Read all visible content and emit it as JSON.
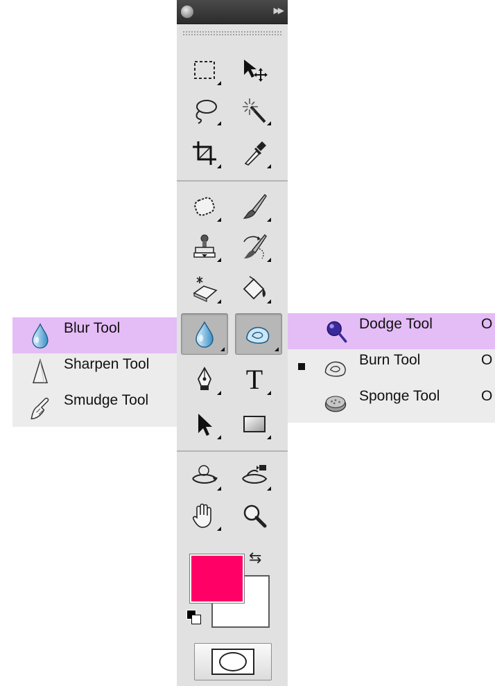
{
  "toolbar": {
    "tools": [
      {
        "name": "rectangular-marquee",
        "icon": "marquee-icon"
      },
      {
        "name": "move",
        "icon": "move-icon"
      },
      {
        "name": "lasso",
        "icon": "lasso-icon"
      },
      {
        "name": "magic-wand",
        "icon": "magic-wand-icon"
      },
      {
        "name": "crop",
        "icon": "crop-icon"
      },
      {
        "name": "eyedropper",
        "icon": "eyedropper-icon"
      },
      {
        "name": "spot-healing",
        "icon": "bandage-icon"
      },
      {
        "name": "brush",
        "icon": "brush-icon"
      },
      {
        "name": "clone-stamp",
        "icon": "stamp-icon"
      },
      {
        "name": "history-brush",
        "icon": "history-brush-icon"
      },
      {
        "name": "eraser",
        "icon": "eraser-icon"
      },
      {
        "name": "paint-bucket",
        "icon": "paint-bucket-icon"
      },
      {
        "name": "blur",
        "icon": "blur-drop-icon",
        "active": true
      },
      {
        "name": "dodge",
        "icon": "dodge-icon",
        "active": true
      },
      {
        "name": "pen",
        "icon": "pen-icon"
      },
      {
        "name": "type",
        "icon": "type-icon",
        "glyph": "T"
      },
      {
        "name": "path-selection",
        "icon": "arrow-icon"
      },
      {
        "name": "rectangle-shape",
        "icon": "rectangle-icon"
      },
      {
        "name": "3d-rotate",
        "icon": "3d-rotate-icon"
      },
      {
        "name": "3d-orbit",
        "icon": "3d-orbit-icon"
      },
      {
        "name": "hand",
        "icon": "hand-icon"
      },
      {
        "name": "zoom",
        "icon": "zoom-icon"
      }
    ],
    "colors": {
      "foreground": "#ff0066",
      "background": "#ffffff"
    }
  },
  "blur_menu": {
    "items": [
      {
        "label": "Blur Tool",
        "icon": "blur-drop-icon",
        "highlighted": true
      },
      {
        "label": "Sharpen Tool",
        "icon": "sharpen-icon"
      },
      {
        "label": "Smudge Tool",
        "icon": "smudge-icon"
      }
    ]
  },
  "dodge_menu": {
    "items": [
      {
        "label": "Dodge Tool",
        "shortcut": "O",
        "icon": "dodge-icon",
        "highlighted": true
      },
      {
        "label": "Burn Tool",
        "shortcut": "O",
        "icon": "burn-icon",
        "selected": true
      },
      {
        "label": "Sponge Tool",
        "shortcut": "O",
        "icon": "sponge-icon"
      }
    ]
  }
}
